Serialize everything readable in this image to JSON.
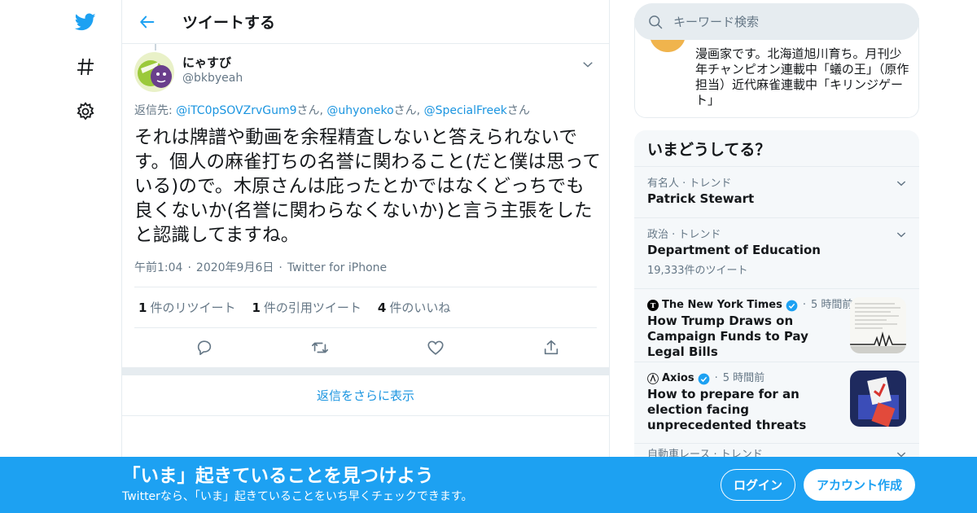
{
  "colors": {
    "accent": "#1da1f2",
    "link": "#1b95e0",
    "muted": "#657786",
    "border": "#e6ecf0"
  },
  "nav": {
    "icons": [
      "twitter-bird-icon",
      "hashtag-icon",
      "gear-icon"
    ]
  },
  "header": {
    "title": "ツイートする"
  },
  "tweet": {
    "display_name": "にゃすび",
    "handle": "@bkbyeah",
    "reply_prefix": "返信先: ",
    "reply_targets": [
      "@iTC0pSOVZrvGum9",
      "@uhyoneko",
      "@SpecialFreek"
    ],
    "reply_suffix": "さん",
    "reply_sep": ", ",
    "text": "それは牌譜や動画を余程精査しないと答えられないです。個人の麻雀打ちの名誉に関わること(だと僕は思っている)ので。木原さんは庇ったとかではなくどっちでも良くないか(名誉に関わらなくないか)と言う主張をしたと認識してますね。",
    "time": "午前1:04",
    "date": "2020年9月6日",
    "source": "Twitter for iPhone",
    "dot": "·",
    "stats": [
      {
        "count": "1",
        "label": "件のリツイート"
      },
      {
        "count": "1",
        "label": "件の引用ツイート"
      },
      {
        "count": "4",
        "label": "件のいいね"
      }
    ]
  },
  "more_replies": "返信をさらに表示",
  "search": {
    "placeholder": "キーワード検索"
  },
  "profile": {
    "bio": "漫画家です。北海道旭川育ち。月刊少年チャンピオン連載中「蟻の王」（原作担当）近代麻雀連載中「キリンジゲート」"
  },
  "trends": {
    "title": "いまどうしてる？",
    "items": [
      {
        "category": "有名人 · トレンド",
        "name": "Patrick Stewart",
        "count": ""
      },
      {
        "category": "政治 · トレンド",
        "name": "Department of Education",
        "count": "19,333件のツイート"
      }
    ],
    "news": [
      {
        "source": "The New York Times",
        "time": "5 時間前",
        "headline": "How Trump Draws on Campaign Funds to Pay Legal Bills"
      },
      {
        "source": "Axios",
        "time": "5 時間前",
        "headline": "How to prepare for an election facing unprecedented threats"
      }
    ],
    "last": {
      "category": "自動車レース · トレンド"
    }
  },
  "banner": {
    "title": "「いま」起きていることを見つけよう",
    "subtitle": "Twitterなら、「いま」起きていることをいち早くチェックできます。",
    "login": "ログイン",
    "signup": "アカウント作成"
  }
}
